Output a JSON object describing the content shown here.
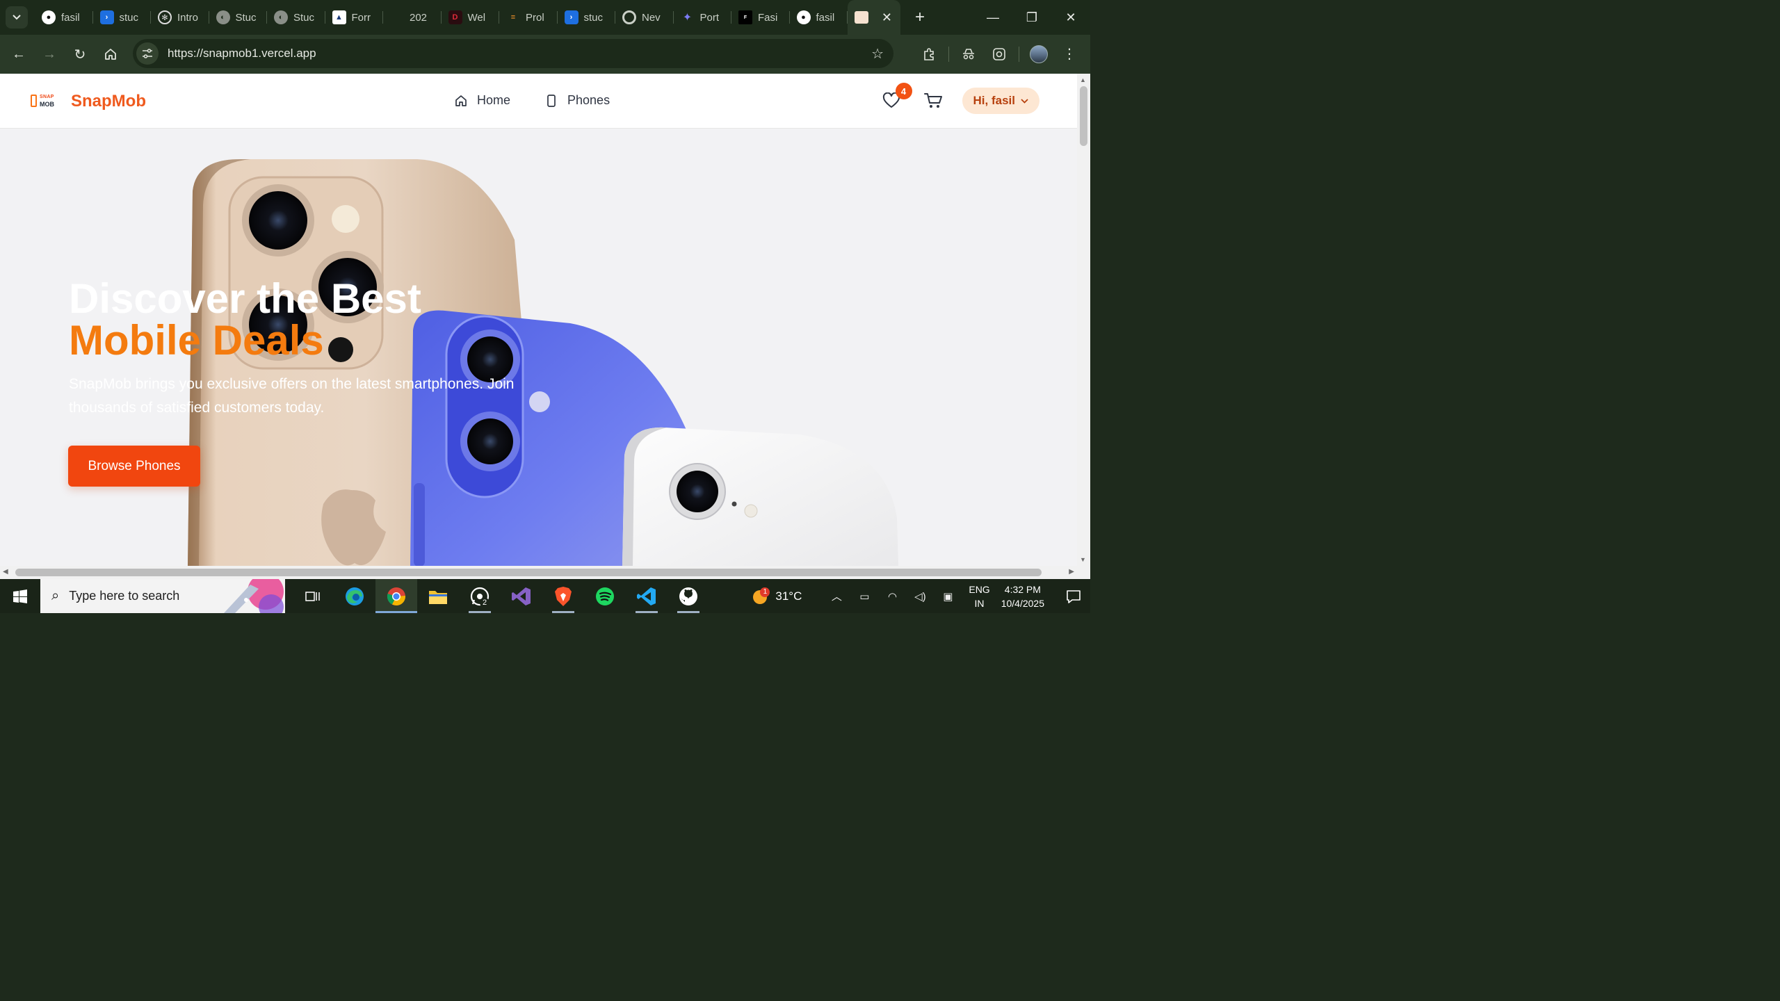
{
  "browser": {
    "tabs": [
      {
        "label": "fasil",
        "icon": "github-icon"
      },
      {
        "label": "stuc",
        "icon": "powerautomate-icon"
      },
      {
        "label": "Intro",
        "icon": "openai-icon"
      },
      {
        "label": "Stuc",
        "icon": "globe-icon"
      },
      {
        "label": "Stuc",
        "icon": "globe-icon"
      },
      {
        "label": "Forr",
        "icon": "graduation-icon"
      },
      {
        "label": "202",
        "icon": "blank-icon"
      },
      {
        "label": "Wel",
        "icon": "d-icon"
      },
      {
        "label": "Prol",
        "icon": "stack-icon"
      },
      {
        "label": "stuc",
        "icon": "powerautomate-icon"
      },
      {
        "label": "Nev",
        "icon": "chrome-icon"
      },
      {
        "label": "Port",
        "icon": "portfolio-icon"
      },
      {
        "label": "Fasi",
        "icon": "fasil-icon"
      },
      {
        "label": "fasil",
        "icon": "github-icon"
      }
    ],
    "active_tab_icon": "snapmob-icon",
    "url": "https://snapmob1.vercel.app"
  },
  "site": {
    "brand": {
      "logo_top": "SNAP",
      "logo_bottom": "MOB",
      "name": "SnapMob"
    },
    "nav": [
      {
        "label": "Home",
        "icon": "home-icon"
      },
      {
        "label": "Phones",
        "icon": "smartphone-icon"
      }
    ],
    "wishlist_count": "4",
    "user_greeting": "Hi, fasil",
    "hero": {
      "title_line1": "Discover the Best",
      "title_line2": "Mobile Deals",
      "subtitle": "SnapMob brings you exclusive offers on the latest smartphones. Join thousands of satisfied customers today.",
      "cta": "Browse Phones"
    },
    "colors": {
      "brand": "#ef5a1e",
      "accent": "#f47b0f",
      "cta": "#f1460f"
    }
  },
  "taskbar": {
    "search_placeholder": "Type here to search",
    "apps": [
      "task-view-icon",
      "edge-icon",
      "chrome-icon",
      "file-explorer-icon",
      "whatsapp-icon",
      "visual-studio-icon",
      "brave-icon",
      "spotify-icon",
      "vscode-icon",
      "github-desktop-icon"
    ],
    "whatsapp_badge": "2",
    "weather_badge": "1",
    "temperature": "31°C",
    "lang_top": "ENG",
    "lang_bottom": "IN",
    "time": "4:32 PM",
    "date": "10/4/2025"
  }
}
